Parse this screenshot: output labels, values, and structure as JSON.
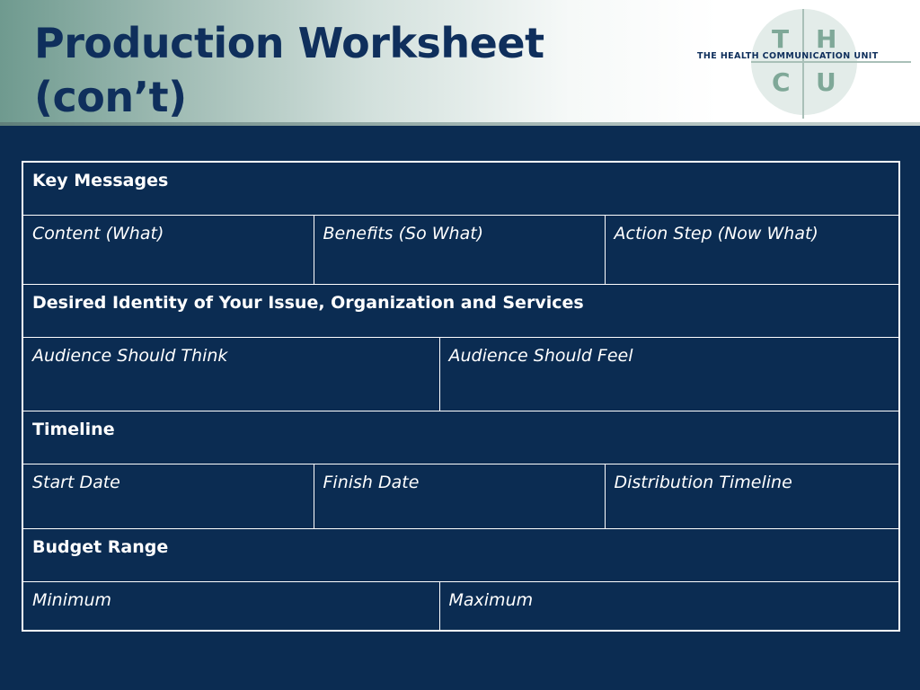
{
  "slide": {
    "title_line1": "Production Worksheet",
    "title_line2": "(con’t)"
  },
  "logo": {
    "letters": [
      "T",
      "H",
      "C",
      "U"
    ],
    "name": "THE HEALTH COMMUNICATION UNIT"
  },
  "colors": {
    "background": "#0b2c52",
    "title": "#0f2f5c",
    "table_text": "#ffffff",
    "logo_accent": "#7fa898"
  },
  "worksheet": {
    "key_messages": {
      "heading": "Key Messages",
      "columns": [
        "Content (What)",
        "Benefits (So What)",
        "Action Step (Now What)"
      ]
    },
    "identity": {
      "heading": "Desired Identity of Your Issue, Organization and Services",
      "columns": [
        "Audience Should Think",
        "Audience Should Feel"
      ]
    },
    "timeline": {
      "heading": "Timeline",
      "columns": [
        "Start Date",
        "Finish Date",
        "Distribution Timeline"
      ]
    },
    "budget": {
      "heading": "Budget Range",
      "columns": [
        "Minimum",
        "Maximum"
      ]
    }
  }
}
